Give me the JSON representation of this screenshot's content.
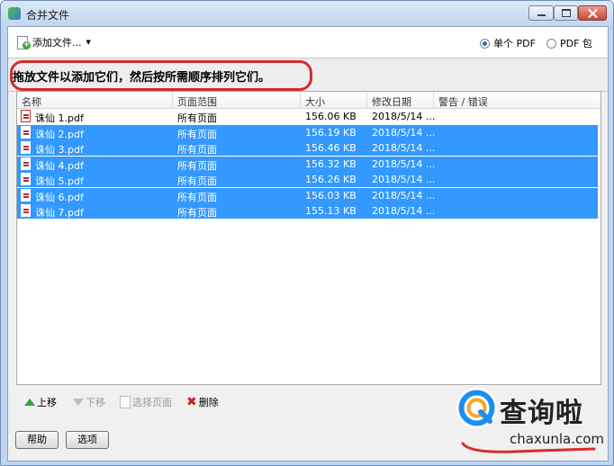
{
  "window": {
    "title": "合并文件"
  },
  "toolbar": {
    "add_files_label": "添加文件...",
    "output_options": [
      {
        "label": "单个 PDF",
        "checked": true
      },
      {
        "label": "PDF 包",
        "checked": false
      }
    ]
  },
  "hint": {
    "text": "拖放文件以添加它们，然后按所需顺序排列它们。"
  },
  "file_table": {
    "columns": [
      "名称",
      "页面范围",
      "大小",
      "修改日期",
      "警告 / 错误"
    ],
    "rows": [
      {
        "name": "诛仙 1.pdf",
        "pages": "所有页面",
        "size": "156.06 KB",
        "date": "2018/5/14 ...",
        "warning": "",
        "selected": false
      },
      {
        "name": "诛仙 2.pdf",
        "pages": "所有页面",
        "size": "156.19 KB",
        "date": "2018/5/14 ...",
        "warning": "",
        "selected": true
      },
      {
        "name": "诛仙 3.pdf",
        "pages": "所有页面",
        "size": "156.46 KB",
        "date": "2018/5/14 ...",
        "warning": "",
        "selected": true
      },
      {
        "name": "诛仙 4.pdf",
        "pages": "所有页面",
        "size": "156.32 KB",
        "date": "2018/5/14 ...",
        "warning": "",
        "selected": true
      },
      {
        "name": "诛仙 5.pdf",
        "pages": "所有页面",
        "size": "156.26 KB",
        "date": "2018/5/14 ...",
        "warning": "",
        "selected": true
      },
      {
        "name": "诛仙 6.pdf",
        "pages": "所有页面",
        "size": "156.03 KB",
        "date": "2018/5/14 ...",
        "warning": "",
        "selected": true
      },
      {
        "name": "诛仙 7.pdf",
        "pages": "所有页面",
        "size": "155.13 KB",
        "date": "2018/5/14 ...",
        "warning": "",
        "selected": true
      }
    ]
  },
  "actions": {
    "move_up": "上移",
    "move_down": "下移",
    "choose_pages": "选择页面",
    "delete": "删除"
  },
  "footer": {
    "help": "帮助",
    "options": "选项"
  },
  "watermark": {
    "text": "查询啦",
    "sub": "chaxunla.com"
  },
  "colors": {
    "selection": "#3399ff",
    "highlight_circle": "#d62c2c"
  }
}
